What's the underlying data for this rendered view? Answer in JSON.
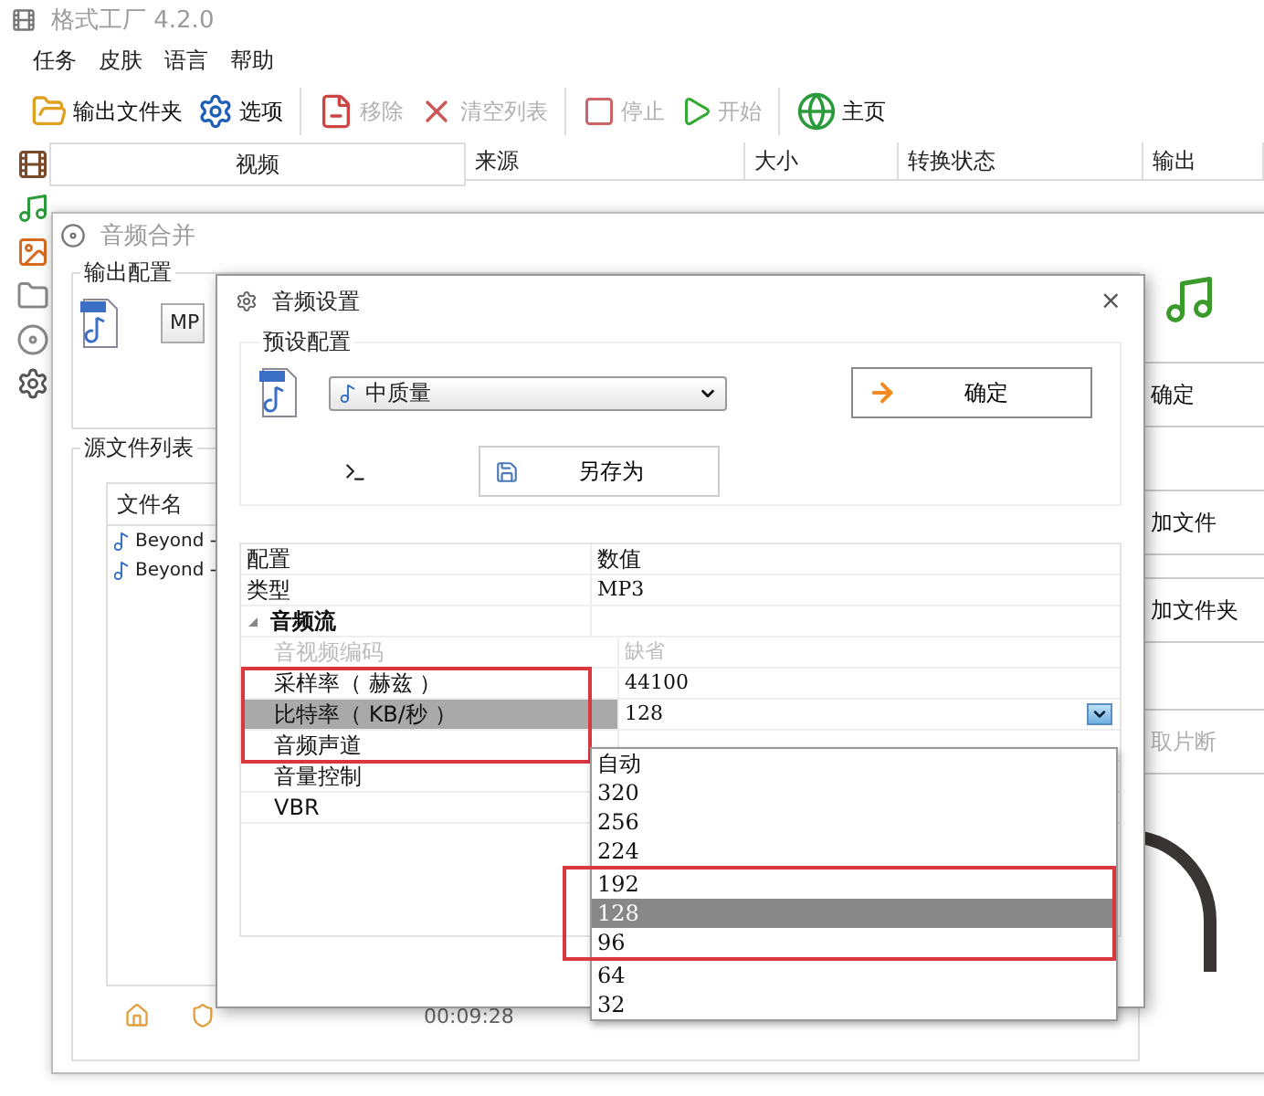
{
  "main_window": {
    "title": "格式工厂 4.2.0",
    "active": false,
    "menu": [
      "任务",
      "皮肤",
      "语言",
      "帮助"
    ],
    "toolbar": [
      {
        "label": "输出文件夹",
        "disabled": false
      },
      {
        "label": "选项",
        "disabled": false
      },
      {
        "label": "移除",
        "disabled": true
      },
      {
        "label": "清空列表",
        "disabled": true
      },
      {
        "label": "停止",
        "disabled": true
      },
      {
        "label": "开始",
        "disabled": true
      },
      {
        "label": "主页",
        "disabled": false
      }
    ],
    "category": "视频",
    "task_table": {
      "columns": [
        "来源",
        "大小",
        "转换状态",
        "输出"
      ]
    }
  },
  "merge_window": {
    "title": "音频合并",
    "active": false,
    "output_group": {
      "title": "输出配置",
      "profile": "MP"
    },
    "actions": [
      {
        "label": "确定",
        "disabled": false
      },
      {
        "label": "加文件",
        "disabled": false
      },
      {
        "label": "加文件夹",
        "disabled": false
      },
      {
        "label": "取片断",
        "disabled": true
      }
    ],
    "source_group": {
      "title": "源文件列表",
      "columns": [
        "文件名"
      ],
      "rows": [
        "Beyond -",
        "Beyond -"
      ]
    },
    "duration": "00:09:28"
  },
  "dialog": {
    "title": "音频设置",
    "close": "×",
    "preset_group": {
      "title": "预设配置",
      "preset": "中质量",
      "ok": "确定",
      "save_as": "另存为"
    },
    "grid": {
      "columns": [
        "配置",
        "数值"
      ],
      "rows": [
        {
          "kind": "property",
          "name": "类型",
          "value": "MP3",
          "disabled": false,
          "selected": false,
          "annotated": false
        },
        {
          "kind": "category",
          "name": "音频流",
          "expanded": true,
          "children": [
            {
              "kind": "property",
              "name": "音视频编码",
              "value": "缺省",
              "disabled": true,
              "selected": false,
              "annotated": false
            },
            {
              "kind": "property",
              "name": "采样率（ 赫兹 ）",
              "value": "44100",
              "disabled": false,
              "selected": false,
              "annotated": true
            },
            {
              "kind": "property",
              "name": "比特率（ KB/秒 ）",
              "value": "128",
              "disabled": false,
              "selected": true,
              "annotated": true
            },
            {
              "kind": "property",
              "name": "音频声道",
              "disabled": false,
              "selected": false,
              "annotated": true
            },
            {
              "kind": "property",
              "name": "音量控制",
              "disabled": false,
              "selected": false,
              "annotated": false
            },
            {
              "kind": "property",
              "name": "VBR",
              "disabled": false,
              "selected": false,
              "annotated": false
            }
          ]
        }
      ]
    },
    "dropdown": {
      "options": [
        {
          "label": "自动",
          "selected": false,
          "annotated": false
        },
        {
          "label": "320",
          "selected": false,
          "annotated": false
        },
        {
          "label": "256",
          "selected": false,
          "annotated": false
        },
        {
          "label": "224",
          "selected": false,
          "annotated": false
        },
        {
          "label": "192",
          "selected": false,
          "annotated": true
        },
        {
          "label": "128",
          "selected": true,
          "annotated": true
        },
        {
          "label": "96",
          "selected": false,
          "annotated": true
        },
        {
          "label": "64",
          "selected": false,
          "annotated": false
        },
        {
          "label": "32",
          "selected": false,
          "annotated": false
        }
      ]
    }
  }
}
